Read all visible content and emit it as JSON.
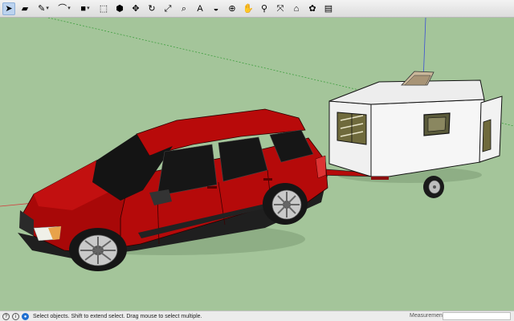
{
  "toolbar": {
    "tools": [
      {
        "name": "select-tool",
        "icon": "arrow-cursor-icon",
        "glyph": "➤",
        "selected": true
      },
      {
        "name": "eraser-tool",
        "icon": "eraser-icon",
        "glyph": "▰"
      },
      {
        "name": "line-tool",
        "icon": "pencil-icon",
        "glyph": "✎",
        "dropdown": true
      },
      {
        "name": "arc-tool",
        "icon": "arc-icon",
        "glyph": "⌒",
        "dropdown": true
      },
      {
        "name": "shape-tool",
        "icon": "rectangle-icon",
        "glyph": "■",
        "dropdown": true
      },
      {
        "name": "push-pull-tool",
        "icon": "push-pull-icon",
        "glyph": "⬚"
      },
      {
        "name": "offset-tool",
        "icon": "offset-icon",
        "glyph": "⬢"
      },
      {
        "name": "move-tool",
        "icon": "move-icon",
        "glyph": "✥"
      },
      {
        "name": "rotate-tool",
        "icon": "rotate-icon",
        "glyph": "↻"
      },
      {
        "name": "scale-tool",
        "icon": "scale-icon",
        "glyph": "⤢"
      },
      {
        "name": "tape-measure-tool",
        "icon": "tape-measure-icon",
        "glyph": "⌕"
      },
      {
        "name": "text-tool",
        "icon": "text-icon",
        "glyph": "A"
      },
      {
        "name": "paint-bucket-tool",
        "icon": "paint-bucket-icon",
        "glyph": "◒"
      },
      {
        "name": "orbit-tool",
        "icon": "orbit-icon",
        "glyph": "⊕"
      },
      {
        "name": "pan-tool",
        "icon": "pan-hand-icon",
        "glyph": "✋"
      },
      {
        "name": "zoom-tool",
        "icon": "zoom-icon",
        "glyph": "⚲"
      },
      {
        "name": "zoom-extents-tool",
        "icon": "zoom-extents-icon",
        "glyph": "⤧"
      },
      {
        "name": "warehouse-tool",
        "icon": "warehouse-icon",
        "glyph": "⌂"
      },
      {
        "name": "extension-warehouse-tool",
        "icon": "extension-warehouse-icon",
        "glyph": "✿"
      },
      {
        "name": "layout-tool",
        "icon": "layout-icon",
        "glyph": "▤"
      }
    ]
  },
  "status": {
    "text": "Select objects. Shift to extend select. Drag mouse to select multiple.",
    "measurements_label": "Measurements",
    "measurements_value": ""
  },
  "colors": {
    "ground": "#a4c59a",
    "car_body": "#b50a0a",
    "car_dark": "#7d0505",
    "trailer_body": "#f4f4f4",
    "axis_red": "#d43b3b",
    "axis_green": "#3f9f3f",
    "axis_blue": "#3b4fd4"
  }
}
